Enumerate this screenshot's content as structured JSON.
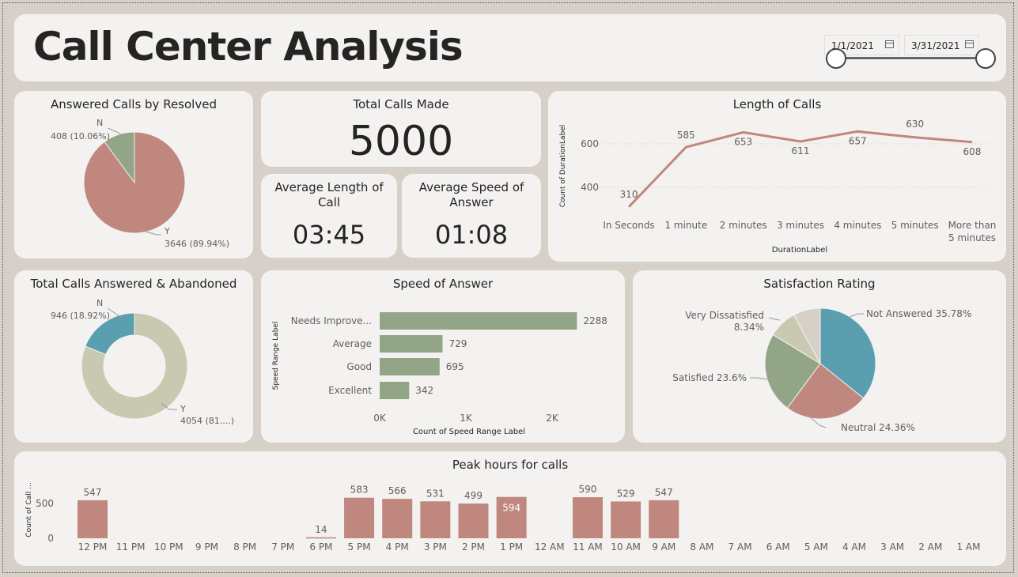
{
  "header": {
    "title": "Call Center Analysis",
    "date_start": "1/1/2021",
    "date_end": "3/31/2021"
  },
  "colors": {
    "rose": "#bf877d",
    "sage": "#93a587",
    "teal": "#5a9fb0",
    "khaki": "#c9c8b0",
    "line": "#c0877c"
  },
  "kpis": {
    "total_calls": {
      "title": "Total Calls Made",
      "value": "5000"
    },
    "avg_length": {
      "title": "Average Length of Call",
      "value": "03:45"
    },
    "avg_speed": {
      "title": "Average Speed of Answer",
      "value": "01:08"
    }
  },
  "chart_data": [
    {
      "id": "resolved",
      "type": "pie",
      "title": "Answered Calls by Resolved",
      "slices": [
        {
          "label": "Y",
          "value": 3646,
          "data_label": "3646 (89.94%)"
        },
        {
          "label": "N",
          "value": 408,
          "data_label": "408 (10.06%)"
        }
      ]
    },
    {
      "id": "length",
      "type": "line",
      "title": "Length of Calls",
      "xlabel": "DurationLabel",
      "ylabel": "Count of DurationLabel",
      "categories": [
        "In Seconds",
        "1 minute",
        "2 minutes",
        "3 minutes",
        "4 minutes",
        "5 minutes",
        "More than 5 minutes"
      ],
      "values": [
        310,
        585,
        653,
        611,
        657,
        630,
        608
      ],
      "yticks": [
        400,
        600
      ]
    },
    {
      "id": "answered",
      "type": "pie",
      "title": "Total Calls Answered & Abandoned",
      "slices": [
        {
          "label": "Y",
          "value": 4054,
          "data_label": "4054 (81....)"
        },
        {
          "label": "N",
          "value": 946,
          "data_label": "946 (18.92%)"
        }
      ]
    },
    {
      "id": "speed",
      "type": "bar",
      "title": "Speed of Answer",
      "xlabel": "Count of Speed Range Label",
      "ylabel": "Speed Range Label",
      "categories": [
        "Needs Improve...",
        "Average",
        "Good",
        "Excellent"
      ],
      "values": [
        2288,
        729,
        695,
        342
      ],
      "xticks": [
        "0K",
        "1K",
        "2K"
      ],
      "xlim": [
        0,
        2500
      ]
    },
    {
      "id": "satisfaction",
      "type": "pie",
      "title": "Satisfaction Rating",
      "slices": [
        {
          "label": "Not Answered",
          "value": 35.78,
          "data_label": "Not Answered 35.78%"
        },
        {
          "label": "Neutral",
          "value": 24.36,
          "data_label": "Neutral 24.36%"
        },
        {
          "label": "Satisfied",
          "value": 23.6,
          "data_label": "Satisfied 23.6%"
        },
        {
          "label": "Very Dissatisfied",
          "value": 8.34,
          "data_label": "Very Dissatisfied 8.34%"
        },
        {
          "label": "Dissatisfied",
          "value": 7.92,
          "data_label": ""
        }
      ]
    },
    {
      "id": "peak",
      "type": "bar",
      "title": "Peak hours for calls",
      "ylabel": "Count of Call ...",
      "categories": [
        "12 PM",
        "11 PM",
        "10 PM",
        "9 PM",
        "8 PM",
        "7 PM",
        "6 PM",
        "5 PM",
        "4 PM",
        "3 PM",
        "2 PM",
        "1 PM",
        "12 AM",
        "11 AM",
        "10 AM",
        "9 AM",
        "8 AM",
        "7 AM",
        "6 AM",
        "5 AM",
        "4 AM",
        "3 AM",
        "2 AM",
        "1 AM"
      ],
      "values": [
        547,
        null,
        null,
        null,
        null,
        null,
        14,
        583,
        566,
        531,
        499,
        594,
        null,
        590,
        529,
        547,
        null,
        null,
        null,
        null,
        null,
        null,
        null,
        null
      ],
      "yticks": [
        0,
        500
      ]
    }
  ]
}
